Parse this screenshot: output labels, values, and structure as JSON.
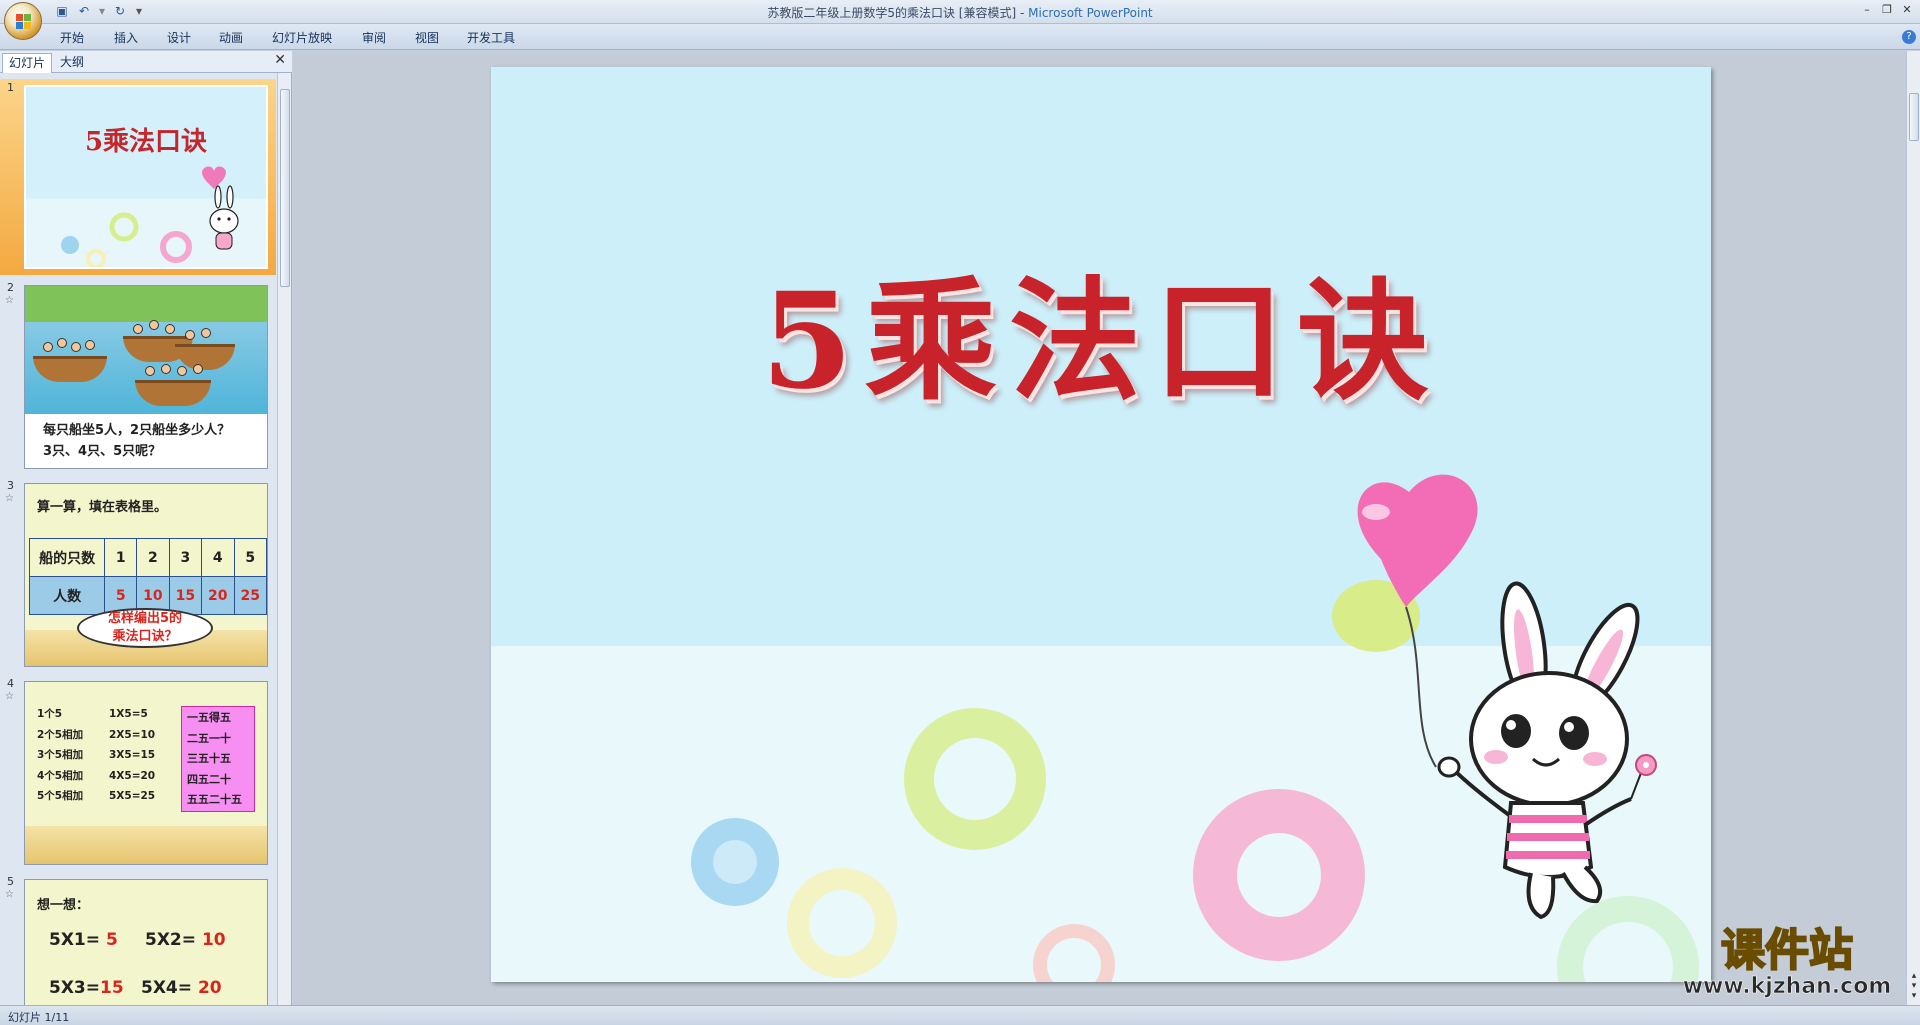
{
  "window": {
    "title": "苏教版二年级上册数学5的乘法口诀 [兼容模式] - ",
    "app_name": "Microsoft PowerPoint"
  },
  "quick_access": {
    "icons": [
      "save-icon",
      "undo-icon",
      "redo-icon",
      "customize-icon"
    ]
  },
  "ribbon": {
    "tabs": [
      "开始",
      "插入",
      "设计",
      "动画",
      "幻灯片放映",
      "审阅",
      "视图",
      "开发工具"
    ]
  },
  "left_pane": {
    "tabs": [
      "幻灯片",
      "大纲"
    ],
    "close_glyph": "✕"
  },
  "thumbnails": {
    "numbers": [
      "1",
      "2",
      "3",
      "4",
      "5"
    ],
    "s1": {
      "title": "5乘法口诀"
    },
    "s2": {
      "lines": [
        "每只船坐5人，2只船坐多少人？",
        "3只、4只、5只呢？"
      ]
    },
    "s3": {
      "heading": "算一算，填在表格里。",
      "row1_header": "船的只数",
      "row1": [
        "1",
        "2",
        "3",
        "4",
        "5"
      ],
      "row2_header": "人数",
      "row2": [
        "5",
        "10",
        "15",
        "20",
        "25"
      ],
      "cloud": [
        "怎样编出5的",
        "乘法口诀？"
      ]
    },
    "s4": {
      "col1": [
        "1个5",
        "2个5相加",
        "3个5相加",
        "4个5相加",
        "5个5相加"
      ],
      "col2": [
        "1X5=5",
        "2X5=10",
        "3X5=15",
        "4X5=20",
        "5X5=25"
      ],
      "col3": [
        "一五得五",
        "二五一十",
        "三五十五",
        "四五二十",
        "五五二十五"
      ]
    },
    "s5": {
      "heading": "想一想：",
      "eq1": "5X1=",
      "ans1": "5",
      "eq2": "5X2=",
      "ans2": "10",
      "eq3": "5X3=",
      "ans3": "15",
      "eq4": "5X4=",
      "ans4": "20"
    }
  },
  "slide": {
    "title": "5乘法口诀"
  },
  "status": {
    "text": "幻灯片 1/11"
  },
  "watermark": {
    "brand": "课件站",
    "url": "www.kjzhan.com"
  },
  "colors": {
    "title_red": "#c8232a",
    "slide_sky": "#cdeff9",
    "selected_orange": "#f4a940"
  }
}
